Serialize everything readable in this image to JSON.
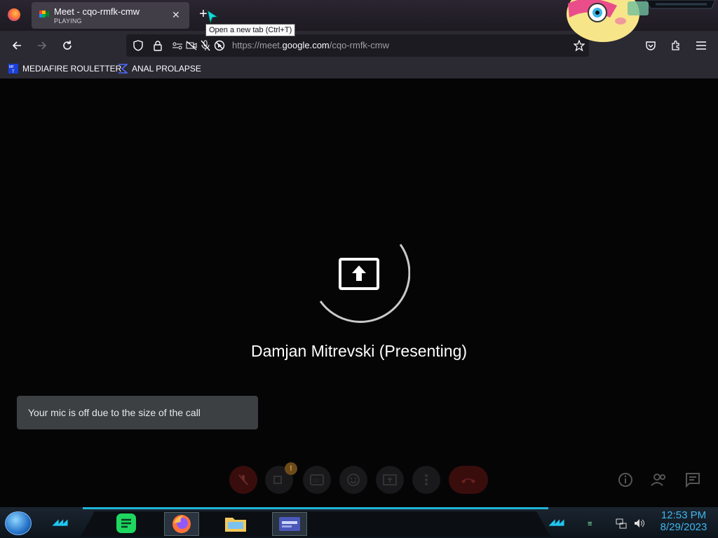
{
  "browser": {
    "tab": {
      "title": "Meet - cqo-rmfk-cmw",
      "status": "PLAYING"
    },
    "new_tab_tooltip": "Open a new tab (Ctrl+T)",
    "url": {
      "prefix": "https://meet.",
      "domain": "google.com",
      "path": "/cqo-rmfk-cmw"
    },
    "bookmarks": [
      {
        "label": "MEDIAFIRE ROULETTER",
        "icon": "mediafire-icon"
      },
      {
        "label": "ANAL PROLAPSE",
        "icon": "sigma-icon"
      }
    ]
  },
  "meet": {
    "presenter": "Damjan Mitrevski (Presenting)",
    "toast": "Your mic is off due to the size of the call",
    "warning_badge": "!"
  },
  "taskbar": {
    "time": "12:53 PM",
    "date": "8/29/2023"
  },
  "colors": {
    "accent": "#1fb4d8",
    "clock": "#3fb6f0",
    "end_call": "#3a0d0d"
  }
}
